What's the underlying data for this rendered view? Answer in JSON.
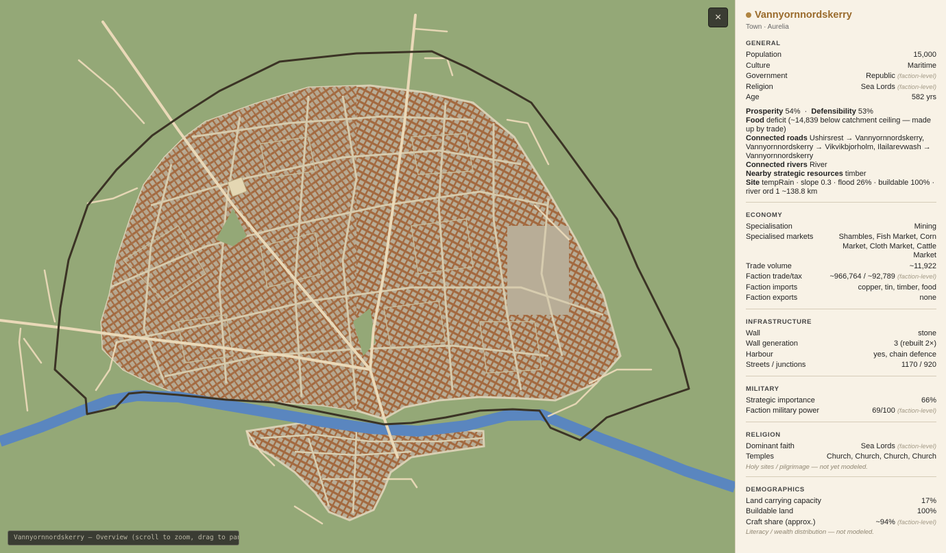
{
  "map": {
    "status_text": "Vannyornnordskerry — Overview (scroll to zoom, drag to pan)",
    "close_label": "×",
    "colors": {
      "land": "#94a877",
      "town": "#b8ad97",
      "buildings": "#a06a44",
      "roads": "#ead9b8",
      "river": "#5a86bf",
      "wall": "#3b3325"
    }
  },
  "panel": {
    "title": "Vannyornnordskerry",
    "subtitle": "Town · Aurelia",
    "general": {
      "heading": "GENERAL",
      "rows": [
        {
          "k": "Population",
          "v": "15,000",
          "note": ""
        },
        {
          "k": "Culture",
          "v": "Maritime",
          "note": ""
        },
        {
          "k": "Government",
          "v": "Republic",
          "note": "(faction-level)"
        },
        {
          "k": "Religion",
          "v": "Sea Lords",
          "note": "(faction-level)"
        },
        {
          "k": "Age",
          "v": "582 yrs",
          "note": ""
        }
      ],
      "prosperity_label": "Prosperity",
      "prosperity_value": "54%",
      "defensibility_label": "Defensibility",
      "defensibility_value": "53%",
      "food_label": "Food",
      "food_value": "deficit (~14,839 below catchment ceiling — made up by trade)",
      "roads_label": "Connected roads",
      "roads_value": "Ushirsrest → Vannyornnordskerry, Vannyornnordskerry → Vikvikbjorholm, Ilailarevwash → Vannyornnordskerry",
      "rivers_label": "Connected rivers",
      "rivers_value": "River",
      "resources_label": "Nearby strategic resources",
      "resources_value": "timber",
      "site_label": "Site",
      "site_value": "tempRain · slope 0.3 · flood 26% · buildable 100% · river ord 1 ~138.8 km"
    },
    "economy": {
      "heading": "ECONOMY",
      "rows": [
        {
          "k": "Specialisation",
          "v": "Mining",
          "note": ""
        },
        {
          "k": "Specialised markets",
          "v": "Shambles, Fish Market, Corn Market, Cloth Market, Cattle Market",
          "note": ""
        },
        {
          "k": "Trade volume",
          "v": "~11,922",
          "note": ""
        },
        {
          "k": "Faction trade/tax",
          "v": "~966,764 / ~92,789",
          "note": "(faction-level)"
        },
        {
          "k": "Faction imports",
          "v": "copper, tin, timber, food",
          "note": ""
        },
        {
          "k": "Faction exports",
          "v": "none",
          "note": ""
        }
      ]
    },
    "infrastructure": {
      "heading": "INFRASTRUCTURE",
      "rows": [
        {
          "k": "Wall",
          "v": "stone",
          "note": ""
        },
        {
          "k": "Wall generation",
          "v": "3 (rebuilt 2×)",
          "note": ""
        },
        {
          "k": "Harbour",
          "v": "yes, chain defence",
          "note": ""
        },
        {
          "k": "Streets / junctions",
          "v": "1170 / 920",
          "note": ""
        }
      ]
    },
    "military": {
      "heading": "MILITARY",
      "rows": [
        {
          "k": "Strategic importance",
          "v": "66%",
          "note": ""
        },
        {
          "k": "Faction military power",
          "v": "69/100",
          "note": "(faction-level)"
        }
      ]
    },
    "religion": {
      "heading": "RELIGION",
      "rows": [
        {
          "k": "Dominant faith",
          "v": "Sea Lords",
          "note": "(faction-level)"
        },
        {
          "k": "Temples",
          "v": "Church, Church, Church, Church",
          "note": ""
        }
      ],
      "footnote": "Holy sites / pilgrimage — not yet modeled."
    },
    "demographics": {
      "heading": "DEMOGRAPHICS",
      "rows": [
        {
          "k": "Land carrying capacity",
          "v": "17%",
          "note": ""
        },
        {
          "k": "Buildable land",
          "v": "100%",
          "note": ""
        },
        {
          "k": "Craft share (approx.)",
          "v": "~94%",
          "note": "(faction-level)"
        }
      ],
      "footnote": "Literacy / wealth distribution — not modeled."
    }
  }
}
